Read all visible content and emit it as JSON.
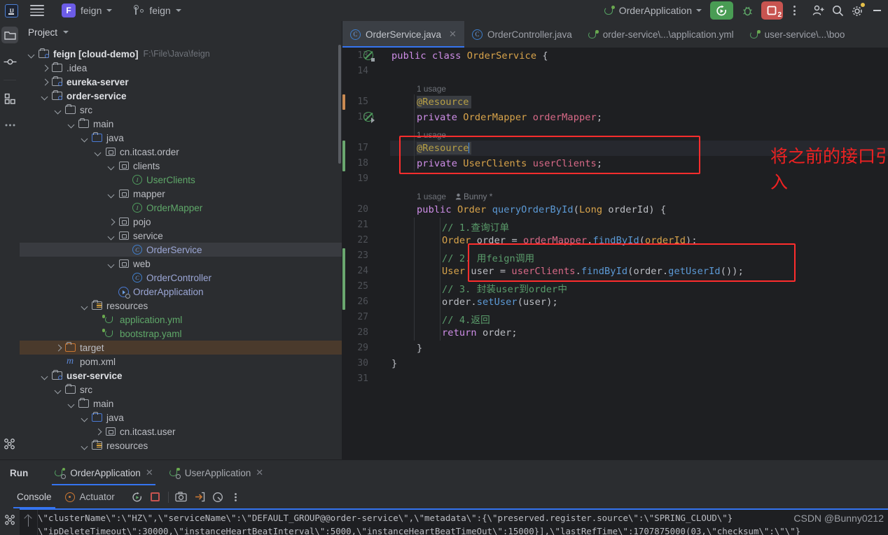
{
  "titlebar": {
    "logo_label": "IJ",
    "project_badge": "F",
    "project_name": "feign",
    "branch_name": "feign",
    "run_config": "OrderApplication",
    "stop_count": "2"
  },
  "rail": {
    "items": [
      {
        "name": "project",
        "icon": "folder-icon",
        "active": true
      },
      {
        "name": "commit",
        "icon": "commit-icon",
        "active": false
      },
      {
        "name": "structure",
        "icon": "structure-icon",
        "active": false
      },
      {
        "name": "more",
        "icon": "more-icon",
        "active": false
      },
      {
        "name": "services",
        "icon": "services-icon",
        "active": false
      }
    ]
  },
  "project_panel": {
    "title": "Project",
    "tree": [
      {
        "depth": 0,
        "arrow": "down",
        "icon": "module-folder-icon",
        "label": "feign [cloud-demo]",
        "bold": true,
        "path": "F:\\File\\Java\\feign"
      },
      {
        "depth": 1,
        "arrow": "right",
        "icon": "folder-icon",
        "label": ".idea"
      },
      {
        "depth": 1,
        "arrow": "right",
        "icon": "module-folder-icon",
        "label": "eureka-server",
        "bold": true
      },
      {
        "depth": 1,
        "arrow": "down",
        "icon": "module-folder-icon",
        "label": "order-service",
        "bold": true
      },
      {
        "depth": 2,
        "arrow": "down",
        "icon": "folder-icon",
        "label": "src"
      },
      {
        "depth": 3,
        "arrow": "down",
        "icon": "folder-icon",
        "label": "main"
      },
      {
        "depth": 4,
        "arrow": "down",
        "icon": "source-folder-icon",
        "label": "java"
      },
      {
        "depth": 5,
        "arrow": "down",
        "icon": "package-icon",
        "label": "cn.itcast.order"
      },
      {
        "depth": 6,
        "arrow": "down",
        "icon": "package-icon",
        "label": "clients"
      },
      {
        "depth": 7,
        "arrow": "none",
        "icon": "interface-icon",
        "label": "UserClients",
        "color": "green"
      },
      {
        "depth": 6,
        "arrow": "down",
        "icon": "package-icon",
        "label": "mapper"
      },
      {
        "depth": 7,
        "arrow": "none",
        "icon": "interface-icon",
        "label": "OrderMapper",
        "color": "green"
      },
      {
        "depth": 6,
        "arrow": "right",
        "icon": "package-icon",
        "label": "pojo"
      },
      {
        "depth": 6,
        "arrow": "down",
        "icon": "package-icon",
        "label": "service"
      },
      {
        "depth": 7,
        "arrow": "none",
        "icon": "class-icon",
        "label": "OrderService",
        "color": "blue",
        "selected": true
      },
      {
        "depth": 6,
        "arrow": "down",
        "icon": "package-icon",
        "label": "web"
      },
      {
        "depth": 7,
        "arrow": "none",
        "icon": "class-icon",
        "label": "OrderController",
        "color": "blue"
      },
      {
        "depth": 6,
        "arrow": "none",
        "icon": "spring-app-icon",
        "label": "OrderApplication",
        "color": "blue"
      },
      {
        "depth": 4,
        "arrow": "down",
        "icon": "resources-folder-icon",
        "label": "resources"
      },
      {
        "depth": 5,
        "arrow": "none",
        "icon": "spring-yaml-icon",
        "label": "application.yml",
        "color": "green"
      },
      {
        "depth": 5,
        "arrow": "none",
        "icon": "spring-yaml-icon",
        "label": "bootstrap.yaml",
        "color": "green"
      },
      {
        "depth": 2,
        "arrow": "right",
        "icon": "target-folder-icon",
        "label": "target",
        "highlight": true
      },
      {
        "depth": 2,
        "arrow": "none",
        "icon": "maven-icon",
        "label": "pom.xml"
      },
      {
        "depth": 1,
        "arrow": "down",
        "icon": "module-folder-icon",
        "label": "user-service",
        "bold": true
      },
      {
        "depth": 2,
        "arrow": "down",
        "icon": "folder-icon",
        "label": "src"
      },
      {
        "depth": 3,
        "arrow": "down",
        "icon": "folder-icon",
        "label": "main"
      },
      {
        "depth": 4,
        "arrow": "down",
        "icon": "source-folder-icon",
        "label": "java"
      },
      {
        "depth": 5,
        "arrow": "right",
        "icon": "package-icon",
        "label": "cn.itcast.user"
      },
      {
        "depth": 4,
        "arrow": "down",
        "icon": "resources-folder-icon",
        "label": "resources"
      }
    ]
  },
  "editor": {
    "tabs": [
      {
        "label": "OrderService.java",
        "icon": "class-icon",
        "active": true,
        "closable": true
      },
      {
        "label": "OrderController.java",
        "icon": "class-icon",
        "active": false,
        "closable": false
      },
      {
        "label": "order-service\\...\\application.yml",
        "icon": "spring-yaml-icon",
        "active": false,
        "closable": false
      },
      {
        "label": "user-service\\...\\boo",
        "icon": "spring-yaml-icon",
        "active": false,
        "closable": false
      }
    ],
    "inlay_hints": [
      {
        "line": 15,
        "text": "1 usage"
      },
      {
        "line": 17,
        "text": "1 usage"
      },
      {
        "line": 20,
        "text": "1 usage",
        "author": "Bunny *"
      }
    ],
    "lines": [
      {
        "no": 13,
        "tokens": [
          {
            "t": "public ",
            "c": "kw"
          },
          {
            "t": "class ",
            "c": "kw"
          },
          {
            "t": "OrderService ",
            "c": "typ"
          },
          {
            "t": "{",
            "c": "punc"
          }
        ]
      },
      {
        "no": 14,
        "tokens": []
      },
      {
        "no": 15,
        "tokens": [
          {
            "t": "@Resource",
            "c": "ann"
          }
        ],
        "indent": 1,
        "annotation_bg": true
      },
      {
        "no": 16,
        "tokens": [
          {
            "t": "private ",
            "c": "kw"
          },
          {
            "t": "OrderMapper ",
            "c": "typ"
          },
          {
            "t": "orderMapper",
            "c": "fld"
          },
          {
            "t": ";",
            "c": "punc"
          }
        ],
        "indent": 1
      },
      {
        "no": 17,
        "tokens": [
          {
            "t": "@Resource",
            "c": "ann"
          }
        ],
        "indent": 1,
        "caret": true,
        "annotation_bg": true
      },
      {
        "no": 18,
        "tokens": [
          {
            "t": "private ",
            "c": "kw"
          },
          {
            "t": "UserClients ",
            "c": "typ"
          },
          {
            "t": "userClients",
            "c": "fld"
          },
          {
            "t": ";",
            "c": "punc"
          }
        ],
        "indent": 1
      },
      {
        "no": 19,
        "tokens": []
      },
      {
        "no": 20,
        "tokens": [
          {
            "t": "public ",
            "c": "kw"
          },
          {
            "t": "Order ",
            "c": "typ"
          },
          {
            "t": "queryOrderById",
            "c": "mth"
          },
          {
            "t": "(",
            "c": "punc"
          },
          {
            "t": "Long ",
            "c": "typ"
          },
          {
            "t": "orderId",
            "c": "txt"
          },
          {
            "t": ") {",
            "c": "punc"
          }
        ],
        "indent": 1
      },
      {
        "no": 21,
        "tokens": [
          {
            "t": "// 1.查询订单",
            "c": "cmt"
          }
        ],
        "indent": 2
      },
      {
        "no": 22,
        "tokens": [
          {
            "t": "Order ",
            "c": "typ"
          },
          {
            "t": "order ",
            "c": "txt"
          },
          {
            "t": "= ",
            "c": "punc"
          },
          {
            "t": "orderMapper",
            "c": "fld"
          },
          {
            "t": ".",
            "c": "punc"
          },
          {
            "t": "findById",
            "c": "mth"
          },
          {
            "t": "(",
            "c": "punc"
          },
          {
            "t": "orderId",
            "c": "typ"
          },
          {
            "t": ");",
            "c": "punc"
          }
        ],
        "indent": 2
      },
      {
        "no": 23,
        "tokens": [
          {
            "t": "// 2. 用feign调用",
            "c": "cmt"
          }
        ],
        "indent": 2
      },
      {
        "no": 24,
        "tokens": [
          {
            "t": "User ",
            "c": "typ"
          },
          {
            "t": "user ",
            "c": "txt"
          },
          {
            "t": "= ",
            "c": "punc"
          },
          {
            "t": "userClients",
            "c": "fld"
          },
          {
            "t": ".",
            "c": "punc"
          },
          {
            "t": "findById",
            "c": "mth"
          },
          {
            "t": "(",
            "c": "punc"
          },
          {
            "t": "order",
            "c": "txt"
          },
          {
            "t": ".",
            "c": "punc"
          },
          {
            "t": "getUserId",
            "c": "mth"
          },
          {
            "t": "());",
            "c": "punc"
          }
        ],
        "indent": 2
      },
      {
        "no": 25,
        "tokens": [
          {
            "t": "// 3. 封装user到order中",
            "c": "cmt"
          }
        ],
        "indent": 2
      },
      {
        "no": 26,
        "tokens": [
          {
            "t": "order",
            "c": "txt"
          },
          {
            "t": ".",
            "c": "punc"
          },
          {
            "t": "setUser",
            "c": "mth"
          },
          {
            "t": "(",
            "c": "punc"
          },
          {
            "t": "user",
            "c": "txt"
          },
          {
            "t": ");",
            "c": "punc"
          }
        ],
        "indent": 2
      },
      {
        "no": 27,
        "tokens": [
          {
            "t": "// 4.返回",
            "c": "cmt"
          }
        ],
        "indent": 2
      },
      {
        "no": 28,
        "tokens": [
          {
            "t": "return ",
            "c": "kw"
          },
          {
            "t": "order",
            "c": "txt"
          },
          {
            "t": ";",
            "c": "punc"
          }
        ],
        "indent": 2
      },
      {
        "no": 29,
        "tokens": [
          {
            "t": "}",
            "c": "punc"
          }
        ],
        "indent": 1
      },
      {
        "no": 30,
        "tokens": [
          {
            "t": "}",
            "c": "punc"
          }
        ],
        "indent": 0
      },
      {
        "no": 31,
        "tokens": []
      }
    ],
    "annotations": [
      {
        "type": "red-box",
        "target_lines": "17-18"
      },
      {
        "type": "red-box",
        "target_lines": "23-24"
      },
      {
        "type": "red-text",
        "text": "将之前的接口引\n入",
        "color": "#ee2222"
      }
    ]
  },
  "run_panel": {
    "title": "Run",
    "tabs": [
      {
        "label": "OrderApplication",
        "icon": "spring-run-icon",
        "active": true
      },
      {
        "label": "UserApplication",
        "icon": "spring-run-icon",
        "active": false
      }
    ],
    "console_tabs": [
      {
        "label": "Console",
        "active": true
      },
      {
        "label": "Actuator",
        "icon": "actuator-icon",
        "active": false
      }
    ],
    "toolbar_icons": [
      "rerun-icon",
      "stop-icon",
      "camera-icon",
      "export-icon",
      "gauge-icon",
      "more-icon"
    ],
    "console_output": [
      "\\\"clusterName\\\":\\\"HZ\\\",\\\"serviceName\\\":\\\"DEFAULT_GROUP@@order-service\\\",\\\"metadata\\\":{\\\"preserved.register.source\\\":\\\"SPRING_CLOUD\\\"}",
      "\\\"ipDeleteTimeout\\\":30000,\\\"instanceHeartBeatInterval\\\":5000,\\\"instanceHeartBeatTimeOut\\\":15000}],\\\"lastRefTime\\\":1707875000(03,\\\"checksum\\\":\\\"\\\"}"
    ]
  },
  "watermark": {
    "text": "CSDN @Bunny0212"
  }
}
